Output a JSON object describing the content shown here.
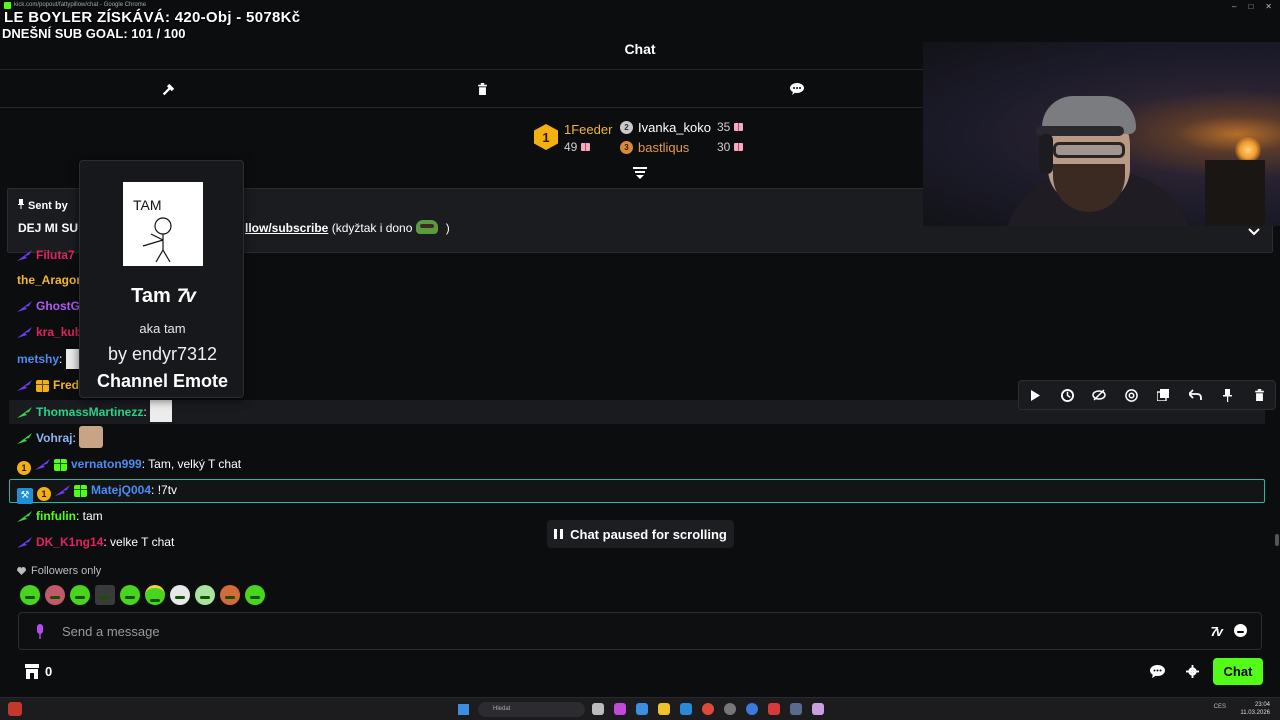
{
  "browser": {
    "url": "kick.com/popout/fattypillow/chat - Google Chrome"
  },
  "overlay": {
    "goal": "LE BOYLER ZÍSKÁVÁ: 420-Obj - 5078Kč",
    "sub_goal": "DNEŠNÍ SUB GOAL: 101 / 100"
  },
  "header": {
    "title": "Chat"
  },
  "leaderboard": {
    "first": {
      "rank": "1",
      "name": "1Feeder",
      "value": "49"
    },
    "second": {
      "rank": "2",
      "name": "Ivanka_koko",
      "value": "35"
    },
    "third": {
      "rank": "3",
      "name": "bastliqus",
      "value": "30"
    }
  },
  "pinned": {
    "sent_by": "Sent by",
    "text_left": "DEJ MI SU",
    "link": "llow/subscribe",
    "text_right": " (kdyžtak i dono",
    "close_paren": " )"
  },
  "emote_card": {
    "name": "Tam",
    "provider_mark": "7v",
    "aka": "aka tam",
    "by": "by endyr7312",
    "type": "Channel Emote",
    "image_text": "TAM"
  },
  "messages": [
    {
      "user": "Filuta7",
      "color": "#e0245e",
      "text": ""
    },
    {
      "user": "the_Aragon",
      "color": "#f4b630",
      "text": ""
    },
    {
      "user": "GhostG",
      "color": "#b05cf2",
      "text": ""
    },
    {
      "user": "kra_kub",
      "color": "#e0245e",
      "text": ""
    },
    {
      "user": "metshy",
      "color": "#4a8cf2",
      "text": ""
    },
    {
      "user": "Fred",
      "color": "#f4b630",
      "text": ""
    },
    {
      "user": "ThomassMartinezz",
      "color": "#29d18a",
      "text": ""
    },
    {
      "user": "Vohraj",
      "color": "#8fb3f5",
      "text": ""
    },
    {
      "user": "vernaton999",
      "color": "#4a8cf2",
      "text": "Tam, velký T chat"
    },
    {
      "user": "MatejQ004",
      "color": "#4a8cf2",
      "text": "!7tv"
    },
    {
      "user": "finfulin",
      "color": "#53fc18",
      "text": "tam"
    },
    {
      "user": "DK_K1ng14",
      "color": "#e0245e",
      "text": "velke T chat"
    }
  ],
  "colors": {
    "accent": "#53fc18",
    "highlight_border": "#2fb3a6",
    "gold": "#f2b011"
  },
  "paused_label": "Chat paused for scrolling",
  "followers_label": "Followers only",
  "input": {
    "placeholder": "Send a message",
    "emote_btn": "7v"
  },
  "bottom": {
    "store_count": "0",
    "chat_button": "Chat"
  },
  "taskbar": {
    "search_placeholder": "Hledat",
    "lang": "CES",
    "time": "23:04",
    "date": "11.03.2026"
  }
}
